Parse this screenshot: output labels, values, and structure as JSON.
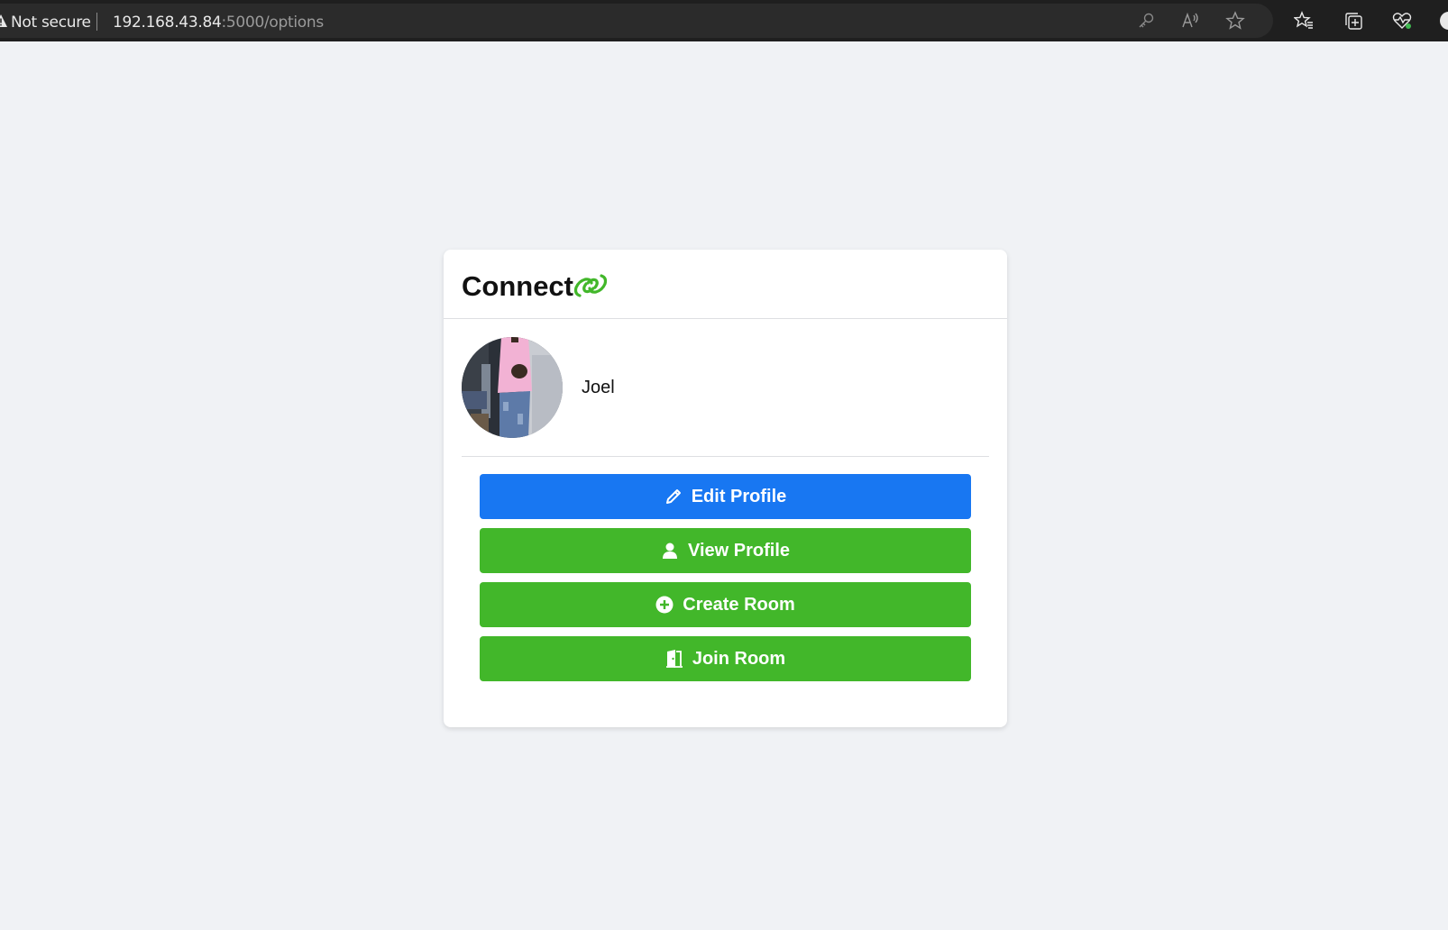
{
  "browser": {
    "security_label": "Not secure",
    "url_host": "192.168.43.84",
    "url_rest": ":5000/options",
    "toolbar_icons": [
      "key-icon",
      "read-aloud-icon",
      "star-icon",
      "favorites-icon",
      "collections-icon",
      "health-icon",
      "profile-icon"
    ]
  },
  "app": {
    "brand": "Connect",
    "brand_logo": "chain-link-icon",
    "brand_color": "#42b72a"
  },
  "profile": {
    "name": "Joel",
    "avatar": "avatar-photo"
  },
  "actions": [
    {
      "label": "Edit Profile",
      "icon": "pencil-icon",
      "color": "#1877f2"
    },
    {
      "label": "View Profile",
      "icon": "user-icon",
      "color": "#42b72a"
    },
    {
      "label": "Create Room",
      "icon": "plus-circle-icon",
      "color": "#42b72a"
    },
    {
      "label": "Join Room",
      "icon": "door-open-icon",
      "color": "#42b72a"
    }
  ]
}
